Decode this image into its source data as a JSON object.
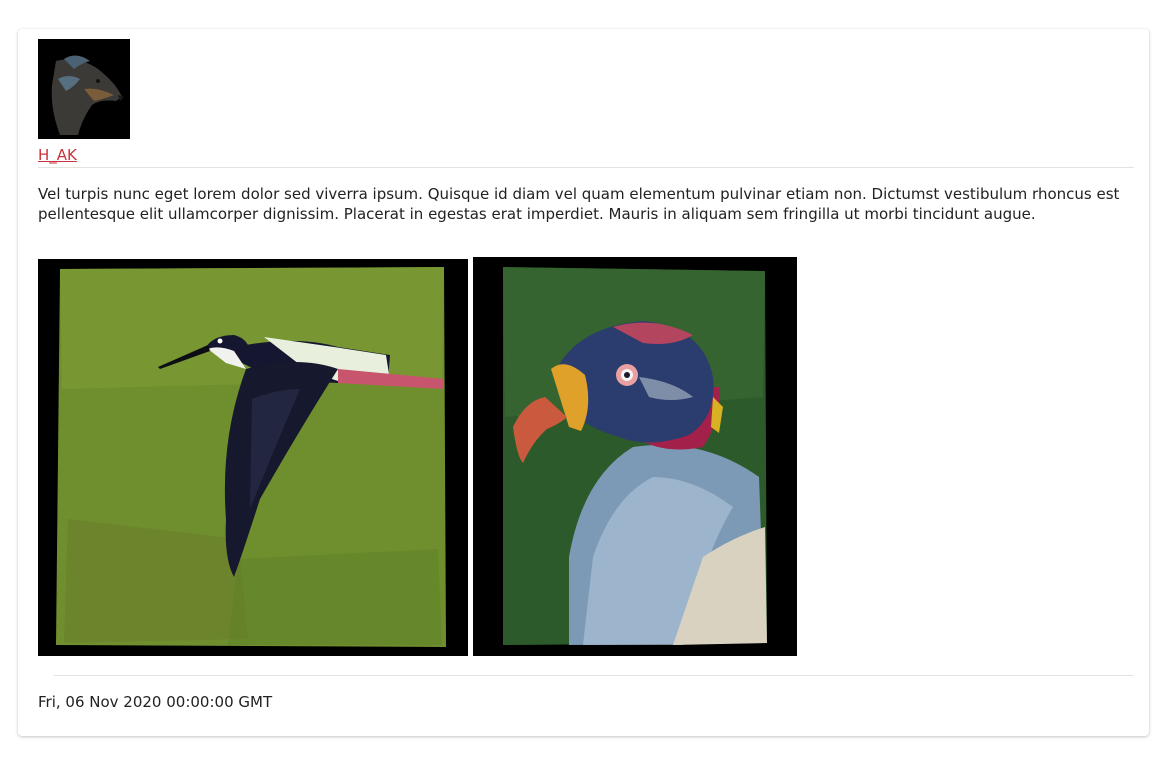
{
  "post": {
    "author": "H_AK",
    "body": "Vel turpis nunc eget lorem dolor sed viverra ipsum. Quisque id diam vel quam elementum pulvinar etiam non. Dictumst vestibulum rhoncus est pellentesque elit ullamcorper dignissim. Placerat in egestas erat imperdiet. Mauris in aliquam sem fringilla ut morbi tincidunt augue.",
    "timestamp": "Fri, 06 Nov 2020 00:00:00 GMT"
  },
  "colors": {
    "link": "#c9333b",
    "divider": "#e3e3e3",
    "text": "#222222"
  },
  "images": [
    {
      "subject": "black-necked stilt painting"
    },
    {
      "subject": "king vulture painting"
    }
  ]
}
